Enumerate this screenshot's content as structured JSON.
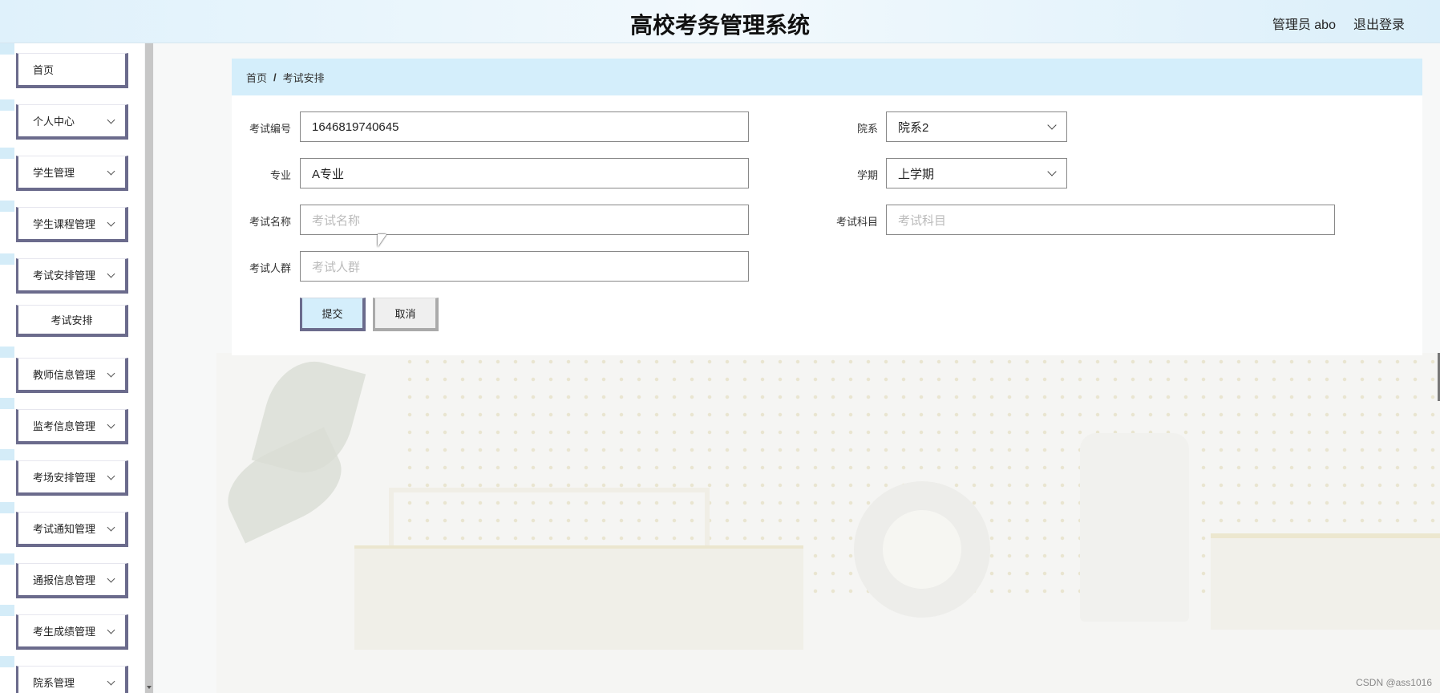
{
  "header": {
    "title": "高校考务管理系统",
    "admin": "管理员 abo",
    "logout": "退出登录"
  },
  "sidebar": {
    "items": [
      {
        "label": "首页"
      },
      {
        "label": "个人中心"
      },
      {
        "label": "学生管理"
      },
      {
        "label": "学生课程管理"
      },
      {
        "label": "考试安排管理"
      },
      {
        "label": "考试安排"
      },
      {
        "label": "教师信息管理"
      },
      {
        "label": "监考信息管理"
      },
      {
        "label": "考场安排管理"
      },
      {
        "label": "考试通知管理"
      },
      {
        "label": "通报信息管理"
      },
      {
        "label": "考生成绩管理"
      },
      {
        "label": "院系管理"
      }
    ]
  },
  "breadcrumb": {
    "home": "首页",
    "separator": "/",
    "current": "考试安排"
  },
  "form": {
    "exam_no": {
      "label": "考试编号",
      "value": "1646819740645"
    },
    "department": {
      "label": "院系",
      "value": "院系2"
    },
    "major": {
      "label": "专业",
      "value": "A专业"
    },
    "semester": {
      "label": "学期",
      "value": "上学期"
    },
    "exam_name": {
      "label": "考试名称",
      "placeholder": "考试名称"
    },
    "exam_subject": {
      "label": "考试科目",
      "placeholder": "考试科目"
    },
    "exam_group": {
      "label": "考试人群",
      "placeholder": "考试人群"
    },
    "submit": "提交",
    "cancel": "取消"
  },
  "watermark": "CSDN @ass1016",
  "colors": {
    "accent": "#d4eefb",
    "border": "#6b6b8c"
  }
}
